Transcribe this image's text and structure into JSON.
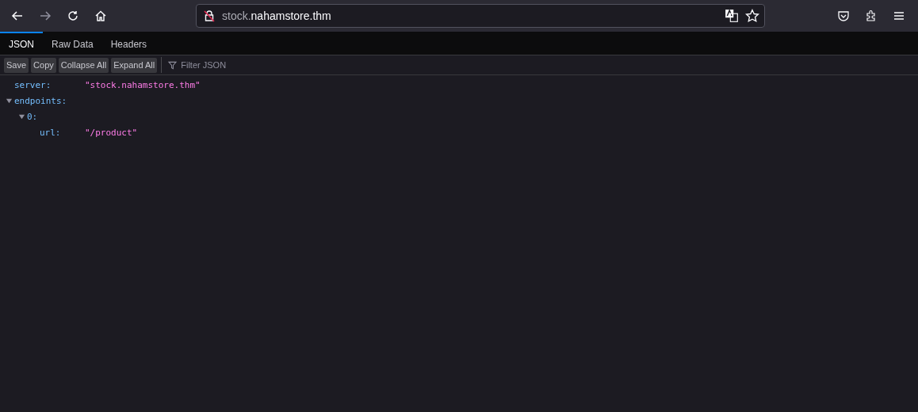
{
  "nav": {
    "back_disabled": false,
    "forward_disabled": true
  },
  "address": {
    "subdomain": "stock.",
    "domain": "nahamstore.thm"
  },
  "tabs": [
    {
      "label": "JSON",
      "selected": true
    },
    {
      "label": "Raw Data",
      "selected": false
    },
    {
      "label": "Headers",
      "selected": false
    }
  ],
  "toolbar": {
    "buttons": [
      "Save",
      "Copy",
      "Collapse All",
      "Expand All"
    ],
    "filter": {
      "placeholder": "Filter JSON"
    }
  },
  "tree": [
    {
      "key": "server:",
      "value": "\"stock.nahamstore.thm\""
    },
    {
      "key": "endpoints:",
      "expanded": true,
      "children": [
        {
          "key": "0:",
          "expanded": true,
          "children": [
            {
              "key": "url:",
              "value": "\"/product\""
            }
          ]
        }
      ]
    }
  ]
}
